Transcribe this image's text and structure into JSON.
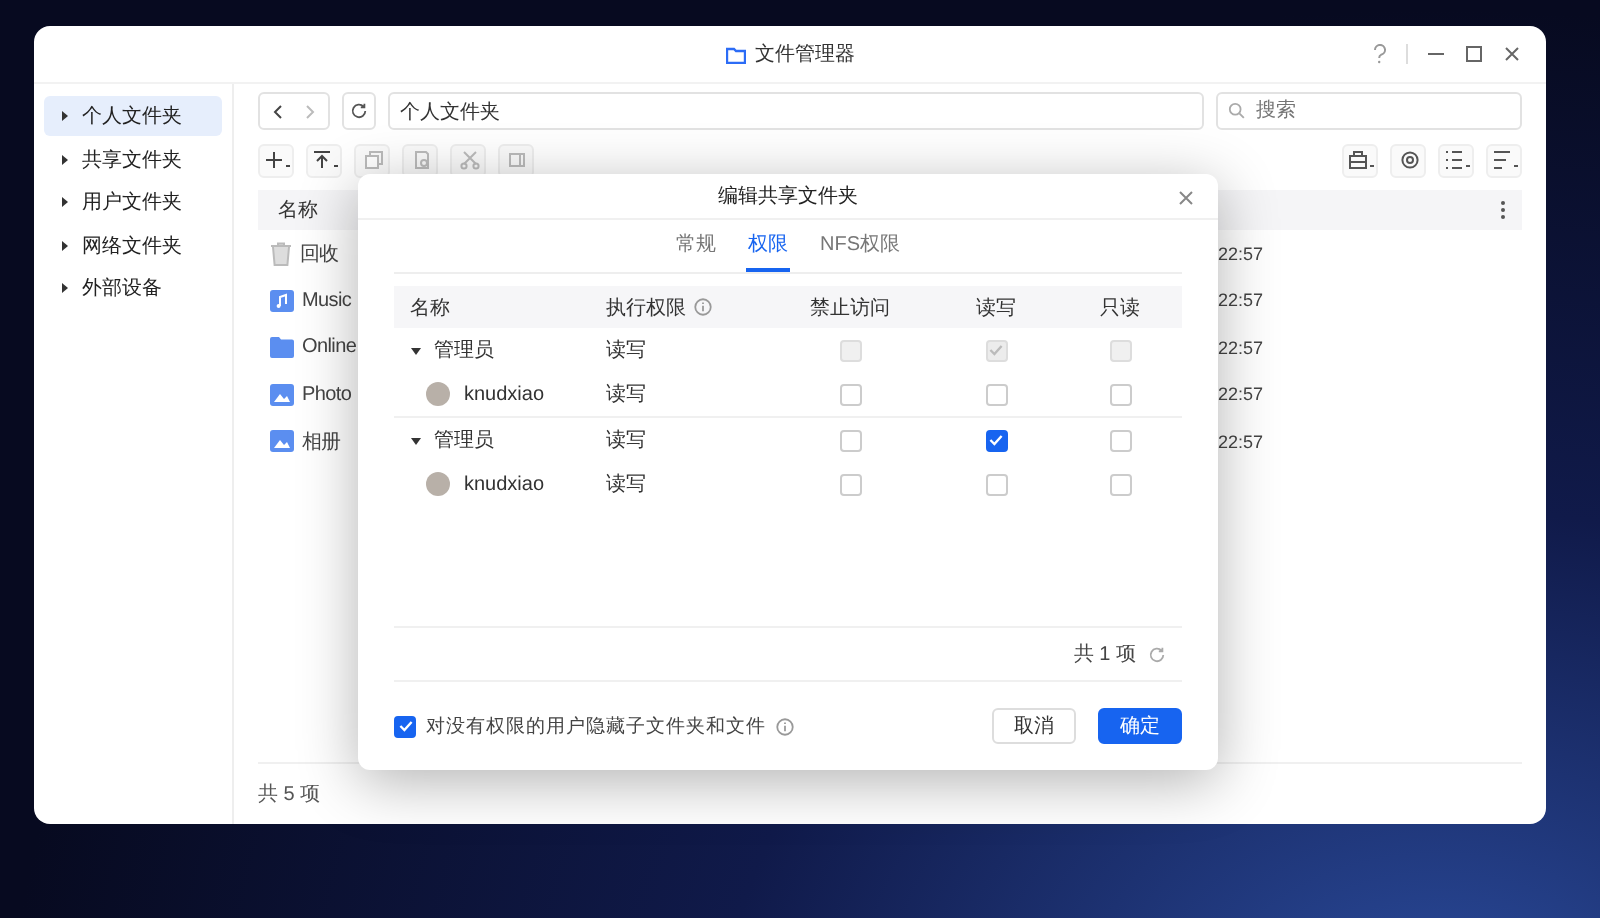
{
  "window": {
    "title": "文件管理器"
  },
  "sidebar": {
    "items": [
      {
        "label": "个人文件夹",
        "selected": true
      },
      {
        "label": "共享文件夹",
        "selected": false
      },
      {
        "label": "用户文件夹",
        "selected": false
      },
      {
        "label": "网络文件夹",
        "selected": false
      },
      {
        "label": "外部设备",
        "selected": false
      }
    ]
  },
  "path": "个人文件夹",
  "search": {
    "placeholder": "搜索"
  },
  "file_list": {
    "column": "名称",
    "rows": [
      {
        "kind": "trash",
        "name": "回收",
        "time": "22:57"
      },
      {
        "kind": "music",
        "name": "Music",
        "time": "22:57"
      },
      {
        "kind": "folder",
        "name": "Online",
        "time": "22:57"
      },
      {
        "kind": "photo",
        "name": "Photo",
        "time": "22:57"
      },
      {
        "kind": "photo",
        "name": "相册",
        "time": "22:57"
      }
    ]
  },
  "status_bar": "共 5 项",
  "dialog": {
    "title": "编辑共享文件夹",
    "tabs": [
      {
        "label": "常规",
        "selected": false
      },
      {
        "label": "权限",
        "selected": true
      },
      {
        "label": "NFS权限",
        "selected": false
      }
    ],
    "columns": [
      "名称",
      "执行权限",
      "禁止访问",
      "读写",
      "只读"
    ],
    "rows": [
      {
        "name": "管理员",
        "exec": "读写",
        "expanded": true,
        "perms": [
          {
            "checked": false,
            "disabled": true
          },
          {
            "checked": true,
            "disabled": true
          },
          {
            "checked": false,
            "disabled": true
          }
        ],
        "children": [
          {
            "name": "knudxiao",
            "exec": "读写",
            "perms": [
              {
                "checked": false,
                "disabled": false
              },
              {
                "checked": false,
                "disabled": false
              },
              {
                "checked": false,
                "disabled": false
              }
            ]
          }
        ]
      },
      {
        "name": "管理员",
        "exec": "读写",
        "expanded": true,
        "perms": [
          {
            "checked": false,
            "disabled": false
          },
          {
            "checked": true,
            "disabled": false
          },
          {
            "checked": false,
            "disabled": false
          }
        ],
        "children": [
          {
            "name": "knudxiao",
            "exec": "读写",
            "perms": [
              {
                "checked": false,
                "disabled": false
              },
              {
                "checked": false,
                "disabled": false
              },
              {
                "checked": false,
                "disabled": false
              }
            ]
          }
        ]
      }
    ],
    "count": "共 1 项",
    "hide_option": {
      "label": "对没有权限的用户隐藏子文件夹和文件",
      "checked": true
    },
    "buttons": {
      "cancel": "取消",
      "ok": "确定"
    }
  }
}
